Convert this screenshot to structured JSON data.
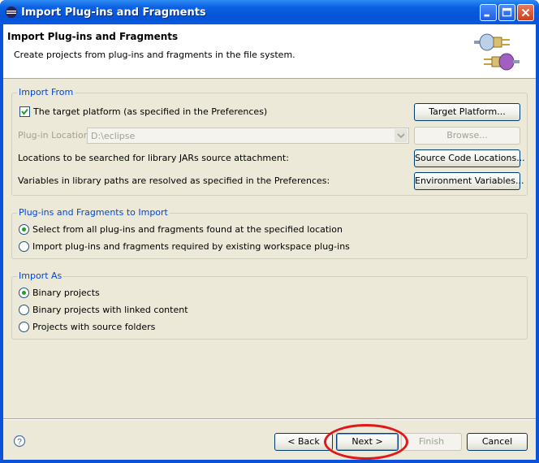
{
  "window": {
    "title": "Import Plug-ins and Fragments"
  },
  "banner": {
    "title": "Import Plug-ins and Fragments",
    "description": "Create projects from plug-ins and fragments in the file system."
  },
  "import_from": {
    "group_label": "Import From",
    "target_platform_checkbox": {
      "label": "The target platform (as specified in the Preferences)",
      "checked": true
    },
    "target_platform_button": "Target Platform...",
    "plugin_location_label": "Plug-in Location:",
    "plugin_location_value": "D:\\eclipse",
    "browse_button": "Browse...",
    "locations_text": "Locations to be searched for library JARs source attachment:",
    "source_code_button": "Source Code Locations...",
    "variables_text": "Variables in library paths are resolved as specified in the Preferences:",
    "env_vars_button": "Environment Variables..."
  },
  "to_import": {
    "group_label": "Plug-ins and Fragments to Import",
    "options": [
      {
        "label": "Select from all plug-ins and fragments found at the specified location",
        "selected": true
      },
      {
        "label": "Import plug-ins and fragments required by existing workspace plug-ins",
        "selected": false
      }
    ]
  },
  "import_as": {
    "group_label": "Import As",
    "options": [
      {
        "label": "Binary projects",
        "selected": true
      },
      {
        "label": "Binary projects with linked content",
        "selected": false
      },
      {
        "label": "Projects with source folders",
        "selected": false
      }
    ]
  },
  "footer": {
    "back_button": "< Back",
    "next_button": "Next >",
    "finish_button": "Finish",
    "cancel_button": "Cancel"
  },
  "colors": {
    "titlebar": "#0553d6",
    "dialog_bg": "#ece9d8",
    "group_label": "#0046d5",
    "highlight_ellipse": "#e01818"
  },
  "icons": [
    "eclipse-icon",
    "minimize-icon",
    "maximize-icon",
    "close-icon",
    "plugin-banner-icon",
    "help-icon"
  ]
}
